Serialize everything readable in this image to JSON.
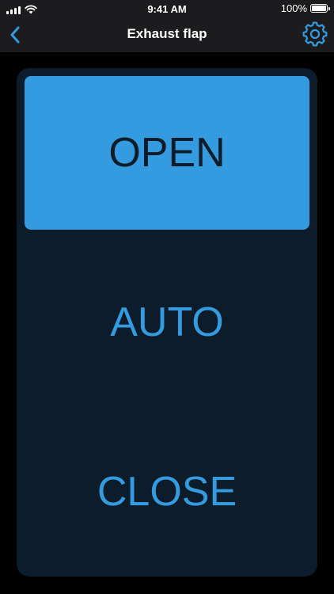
{
  "status_bar": {
    "time": "9:41 AM",
    "battery_percent": "100%",
    "battery_level": 1.0
  },
  "nav": {
    "title": "Exhaust flap",
    "back_icon": "chevron-left-icon",
    "settings_icon": "gear-icon"
  },
  "modes": {
    "open_label": "OPEN",
    "auto_label": "AUTO",
    "close_label": "CLOSE",
    "selected": "OPEN"
  },
  "colors": {
    "accent": "#349be0",
    "panel_background": "#0d1c2a",
    "header_background": "#1c1c1e",
    "selected_text": "#0e1b28"
  }
}
